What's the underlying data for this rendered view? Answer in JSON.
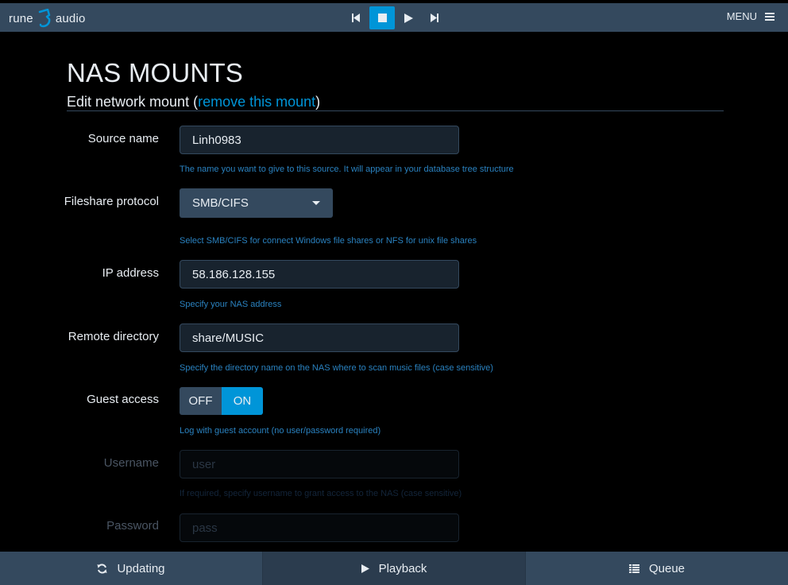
{
  "header": {
    "logo_left": "rune",
    "logo_right": "audio",
    "transport": [
      {
        "icon": "skip-previous-icon"
      },
      {
        "icon": "stop-icon",
        "active": true
      },
      {
        "icon": "play-icon"
      },
      {
        "icon": "skip-next-icon"
      }
    ],
    "menu_label": "MENU"
  },
  "page": {
    "title": "NAS MOUNTS",
    "legend_prefix": "Edit network mount (",
    "legend_link": "remove this mount",
    "legend_suffix": ")"
  },
  "form": {
    "source_name": {
      "label": "Source name",
      "value": "Linh0983",
      "help": "The name you want to give to this source. It will appear in your database tree structure"
    },
    "protocol": {
      "label": "Fileshare protocol",
      "value": "SMB/CIFS",
      "help": "Select SMB/CIFS for connect Windows file shares or NFS for unix file shares"
    },
    "ip_address": {
      "label": "IP address",
      "value": "58.186.128.155",
      "help": "Specify your NAS address"
    },
    "remote_directory": {
      "label": "Remote directory",
      "value": "share/MUSIC",
      "help": "Specify the directory name on the NAS where to scan music files (case sensitive)"
    },
    "guest_access": {
      "label": "Guest access",
      "off_label": "OFF",
      "on_label": "ON",
      "value": "ON",
      "help": "Log with guest account (no user/password required)"
    },
    "username": {
      "label": "Username",
      "placeholder": "user",
      "help": "If required, specify username to grant access to the NAS (case sensitive)"
    },
    "password": {
      "label": "Password",
      "placeholder": "pass"
    }
  },
  "footer": {
    "tabs": [
      {
        "label": "Updating",
        "icon": "refresh-icon"
      },
      {
        "label": "Playback",
        "icon": "play-icon",
        "active": true
      },
      {
        "label": "Queue",
        "icon": "list-icon"
      }
    ]
  },
  "colors": {
    "accent": "#0095d8",
    "bar": "#34495e",
    "background": "#000000"
  }
}
